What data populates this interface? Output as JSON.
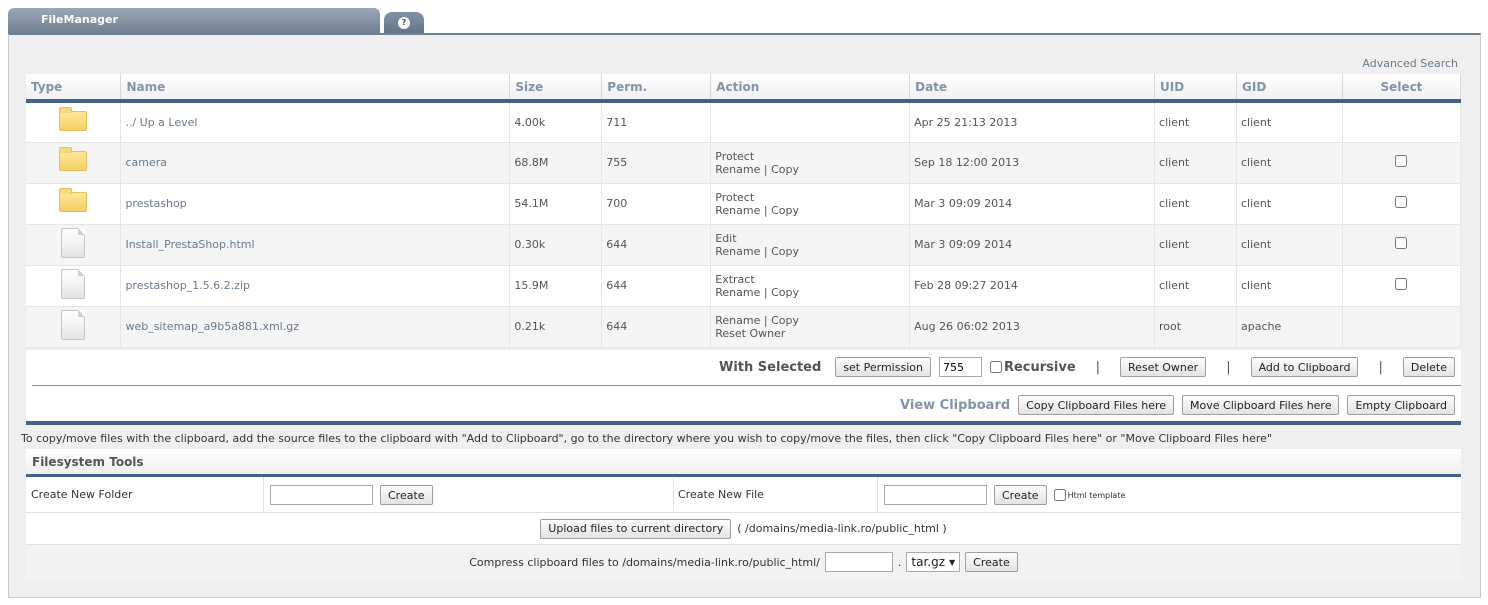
{
  "header": {
    "tab_title": "FileManager",
    "help_icon": "?"
  },
  "advanced_search": "Advanced Search",
  "columns": [
    "Type",
    "Name",
    "Size",
    "Perm.",
    "Action",
    "Date",
    "UID",
    "GID",
    "Select"
  ],
  "rows": [
    {
      "type": "folder",
      "name": "../ Up a Level",
      "size": "4.00k",
      "perm": "711",
      "action1": [],
      "action2": [],
      "date": "Apr 25 21:13 2013",
      "uid": "client",
      "gid": "client",
      "selectable": false
    },
    {
      "type": "folder",
      "name": "camera",
      "size": "68.8M",
      "perm": "755",
      "action1": [
        "Protect"
      ],
      "action2": [
        "Rename",
        "Copy"
      ],
      "date": "Sep 18 12:00 2013",
      "uid": "client",
      "gid": "client",
      "selectable": true
    },
    {
      "type": "folder",
      "name": "prestashop",
      "size": "54.1M",
      "perm": "700",
      "action1": [
        "Protect"
      ],
      "action2": [
        "Rename",
        "Copy"
      ],
      "date": "Mar 3 09:09 2014",
      "uid": "client",
      "gid": "client",
      "selectable": true
    },
    {
      "type": "file",
      "name": "Install_PrestaShop.html",
      "size": "0.30k",
      "perm": "644",
      "action1": [
        "Edit"
      ],
      "action2": [
        "Rename",
        "Copy"
      ],
      "date": "Mar 3 09:09 2014",
      "uid": "client",
      "gid": "client",
      "selectable": true
    },
    {
      "type": "file",
      "name": "prestashop_1.5.6.2.zip",
      "size": "15.9M",
      "perm": "644",
      "action1": [
        "Extract"
      ],
      "action2": [
        "Rename",
        "Copy"
      ],
      "date": "Feb 28 09:27 2014",
      "uid": "client",
      "gid": "client",
      "selectable": true
    },
    {
      "type": "file",
      "name": "web_sitemap_a9b5a881.xml.gz",
      "size": "0.21k",
      "perm": "644",
      "action1": [
        "Rename",
        "Copy"
      ],
      "action2": [
        "Reset Owner"
      ],
      "date": "Aug 26 06:02 2013",
      "uid": "root",
      "gid": "apache",
      "selectable": false
    }
  ],
  "with_selected": {
    "label": "With Selected",
    "set_permission": "set Permission",
    "perm_value": "755",
    "recursive": "Recursive",
    "pipe": "|",
    "reset_owner": "Reset Owner",
    "add_to_clipboard": "Add to Clipboard",
    "delete": "Delete"
  },
  "clipboard": {
    "label": "View Clipboard",
    "copy": "Copy Clipboard Files here",
    "move": "Move Clipboard Files here",
    "empty": "Empty Clipboard"
  },
  "info_text": "To copy/move files with the clipboard, add the source files to the clipboard with \"Add to Clipboard\", go to the directory where you wish to copy/move the files, then click \"Copy Clipboard Files here\" or \"Move Clipboard Files here\"",
  "tools": {
    "title": "Filesystem Tools",
    "create_folder_label": "Create New Folder",
    "create_file_label": "Create New File",
    "create": "Create",
    "html_template": "Html template",
    "upload_button": "Upload files to current directory",
    "upload_path": "( /domains/media-link.ro/public_html )",
    "compress_label": "Compress clipboard files to /domains/media-link.ro/public_html/",
    "dot": ".",
    "format": "tar.gz",
    "dropdown_icon": "▼"
  }
}
